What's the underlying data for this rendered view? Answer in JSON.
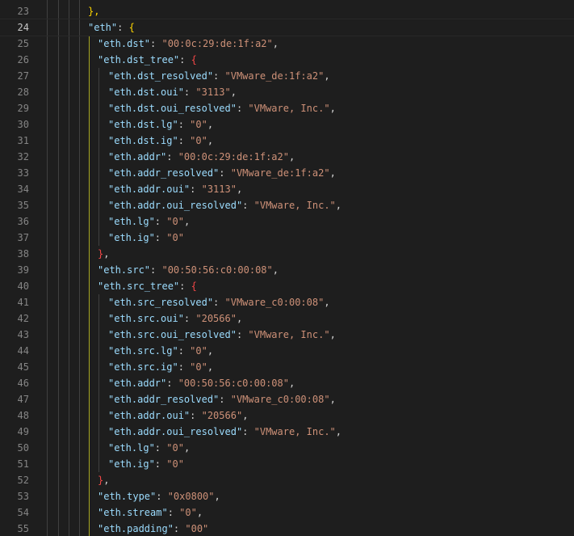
{
  "lines": [
    {
      "num": "23",
      "parts": [
        {
          "t": "},",
          "c": "b1"
        }
      ]
    },
    {
      "num": "24",
      "parts": [
        {
          "t": "\"eth\"",
          "c": "key"
        },
        {
          "t": ": ",
          "c": "punc"
        },
        {
          "t": "{",
          "c": "b1"
        }
      ]
    },
    {
      "num": "25",
      "parts": [
        {
          "t": "\"eth.dst\"",
          "c": "key"
        },
        {
          "t": ": ",
          "c": "punc"
        },
        {
          "t": "\"00:0c:29:de:1f:a2\"",
          "c": "str"
        },
        {
          "t": ",",
          "c": "punc"
        }
      ]
    },
    {
      "num": "26",
      "parts": [
        {
          "t": "\"eth.dst_tree\"",
          "c": "key"
        },
        {
          "t": ": ",
          "c": "punc"
        },
        {
          "t": "{",
          "c": "b3"
        }
      ]
    },
    {
      "num": "27",
      "parts": [
        {
          "t": "\"eth.dst_resolved\"",
          "c": "key"
        },
        {
          "t": ": ",
          "c": "punc"
        },
        {
          "t": "\"VMware_de:1f:a2\"",
          "c": "str"
        },
        {
          "t": ",",
          "c": "punc"
        }
      ]
    },
    {
      "num": "28",
      "parts": [
        {
          "t": "\"eth.dst.oui\"",
          "c": "key"
        },
        {
          "t": ": ",
          "c": "punc"
        },
        {
          "t": "\"3113\"",
          "c": "str"
        },
        {
          "t": ",",
          "c": "punc"
        }
      ]
    },
    {
      "num": "29",
      "parts": [
        {
          "t": "\"eth.dst.oui_resolved\"",
          "c": "key"
        },
        {
          "t": ": ",
          "c": "punc"
        },
        {
          "t": "\"VMware, Inc.\"",
          "c": "str"
        },
        {
          "t": ",",
          "c": "punc"
        }
      ]
    },
    {
      "num": "30",
      "parts": [
        {
          "t": "\"eth.dst.lg\"",
          "c": "key"
        },
        {
          "t": ": ",
          "c": "punc"
        },
        {
          "t": "\"0\"",
          "c": "str"
        },
        {
          "t": ",",
          "c": "punc"
        }
      ]
    },
    {
      "num": "31",
      "parts": [
        {
          "t": "\"eth.dst.ig\"",
          "c": "key"
        },
        {
          "t": ": ",
          "c": "punc"
        },
        {
          "t": "\"0\"",
          "c": "str"
        },
        {
          "t": ",",
          "c": "punc"
        }
      ]
    },
    {
      "num": "32",
      "parts": [
        {
          "t": "\"eth.addr\"",
          "c": "key"
        },
        {
          "t": ": ",
          "c": "punc"
        },
        {
          "t": "\"00:0c:29:de:1f:a2\"",
          "c": "str"
        },
        {
          "t": ",",
          "c": "punc"
        }
      ]
    },
    {
      "num": "33",
      "parts": [
        {
          "t": "\"eth.addr_resolved\"",
          "c": "key"
        },
        {
          "t": ": ",
          "c": "punc"
        },
        {
          "t": "\"VMware_de:1f:a2\"",
          "c": "str"
        },
        {
          "t": ",",
          "c": "punc"
        }
      ]
    },
    {
      "num": "34",
      "parts": [
        {
          "t": "\"eth.addr.oui\"",
          "c": "key"
        },
        {
          "t": ": ",
          "c": "punc"
        },
        {
          "t": "\"3113\"",
          "c": "str"
        },
        {
          "t": ",",
          "c": "punc"
        }
      ]
    },
    {
      "num": "35",
      "parts": [
        {
          "t": "\"eth.addr.oui_resolved\"",
          "c": "key"
        },
        {
          "t": ": ",
          "c": "punc"
        },
        {
          "t": "\"VMware, Inc.\"",
          "c": "str"
        },
        {
          "t": ",",
          "c": "punc"
        }
      ]
    },
    {
      "num": "36",
      "parts": [
        {
          "t": "\"eth.lg\"",
          "c": "key"
        },
        {
          "t": ": ",
          "c": "punc"
        },
        {
          "t": "\"0\"",
          "c": "str"
        },
        {
          "t": ",",
          "c": "punc"
        }
      ]
    },
    {
      "num": "37",
      "parts": [
        {
          "t": "\"eth.ig\"",
          "c": "key"
        },
        {
          "t": ": ",
          "c": "punc"
        },
        {
          "t": "\"0\"",
          "c": "str"
        }
      ]
    },
    {
      "num": "38",
      "parts": [
        {
          "t": "}",
          "c": "b3"
        },
        {
          "t": ",",
          "c": "punc"
        }
      ]
    },
    {
      "num": "39",
      "parts": [
        {
          "t": "\"eth.src\"",
          "c": "key"
        },
        {
          "t": ": ",
          "c": "punc"
        },
        {
          "t": "\"00:50:56:c0:00:08\"",
          "c": "str"
        },
        {
          "t": ",",
          "c": "punc"
        }
      ]
    },
    {
      "num": "40",
      "parts": [
        {
          "t": "\"eth.src_tree\"",
          "c": "key"
        },
        {
          "t": ": ",
          "c": "punc"
        },
        {
          "t": "{",
          "c": "b3"
        }
      ]
    },
    {
      "num": "41",
      "parts": [
        {
          "t": "\"eth.src_resolved\"",
          "c": "key"
        },
        {
          "t": ": ",
          "c": "punc"
        },
        {
          "t": "\"VMware_c0:00:08\"",
          "c": "str"
        },
        {
          "t": ",",
          "c": "punc"
        }
      ]
    },
    {
      "num": "42",
      "parts": [
        {
          "t": "\"eth.src.oui\"",
          "c": "key"
        },
        {
          "t": ": ",
          "c": "punc"
        },
        {
          "t": "\"20566\"",
          "c": "str"
        },
        {
          "t": ",",
          "c": "punc"
        }
      ]
    },
    {
      "num": "43",
      "parts": [
        {
          "t": "\"eth.src.oui_resolved\"",
          "c": "key"
        },
        {
          "t": ": ",
          "c": "punc"
        },
        {
          "t": "\"VMware, Inc.\"",
          "c": "str"
        },
        {
          "t": ",",
          "c": "punc"
        }
      ]
    },
    {
      "num": "44",
      "parts": [
        {
          "t": "\"eth.src.lg\"",
          "c": "key"
        },
        {
          "t": ": ",
          "c": "punc"
        },
        {
          "t": "\"0\"",
          "c": "str"
        },
        {
          "t": ",",
          "c": "punc"
        }
      ]
    },
    {
      "num": "45",
      "parts": [
        {
          "t": "\"eth.src.ig\"",
          "c": "key"
        },
        {
          "t": ": ",
          "c": "punc"
        },
        {
          "t": "\"0\"",
          "c": "str"
        },
        {
          "t": ",",
          "c": "punc"
        }
      ]
    },
    {
      "num": "46",
      "parts": [
        {
          "t": "\"eth.addr\"",
          "c": "key"
        },
        {
          "t": ": ",
          "c": "punc"
        },
        {
          "t": "\"00:50:56:c0:00:08\"",
          "c": "str"
        },
        {
          "t": ",",
          "c": "punc"
        }
      ]
    },
    {
      "num": "47",
      "parts": [
        {
          "t": "\"eth.addr_resolved\"",
          "c": "key"
        },
        {
          "t": ": ",
          "c": "punc"
        },
        {
          "t": "\"VMware_c0:00:08\"",
          "c": "str"
        },
        {
          "t": ",",
          "c": "punc"
        }
      ]
    },
    {
      "num": "48",
      "parts": [
        {
          "t": "\"eth.addr.oui\"",
          "c": "key"
        },
        {
          "t": ": ",
          "c": "punc"
        },
        {
          "t": "\"20566\"",
          "c": "str"
        },
        {
          "t": ",",
          "c": "punc"
        }
      ]
    },
    {
      "num": "49",
      "parts": [
        {
          "t": "\"eth.addr.oui_resolved\"",
          "c": "key"
        },
        {
          "t": ": ",
          "c": "punc"
        },
        {
          "t": "\"VMware, Inc.\"",
          "c": "str"
        },
        {
          "t": ",",
          "c": "punc"
        }
      ]
    },
    {
      "num": "50",
      "parts": [
        {
          "t": "\"eth.lg\"",
          "c": "key"
        },
        {
          "t": ": ",
          "c": "punc"
        },
        {
          "t": "\"0\"",
          "c": "str"
        },
        {
          "t": ",",
          "c": "punc"
        }
      ]
    },
    {
      "num": "51",
      "parts": [
        {
          "t": "\"eth.ig\"",
          "c": "key"
        },
        {
          "t": ": ",
          "c": "punc"
        },
        {
          "t": "\"0\"",
          "c": "str"
        }
      ]
    },
    {
      "num": "52",
      "parts": [
        {
          "t": "}",
          "c": "b3"
        },
        {
          "t": ",",
          "c": "punc"
        }
      ]
    },
    {
      "num": "53",
      "parts": [
        {
          "t": "\"eth.type\"",
          "c": "key"
        },
        {
          "t": ": ",
          "c": "punc"
        },
        {
          "t": "\"0x0800\"",
          "c": "str"
        },
        {
          "t": ",",
          "c": "punc"
        }
      ]
    },
    {
      "num": "54",
      "parts": [
        {
          "t": "\"eth.stream\"",
          "c": "key"
        },
        {
          "t": ": ",
          "c": "punc"
        },
        {
          "t": "\"0\"",
          "c": "str"
        },
        {
          "t": ",",
          "c": "punc"
        }
      ]
    },
    {
      "num": "55",
      "parts": [
        {
          "t": "\"eth.padding\"",
          "c": "key"
        },
        {
          "t": ": ",
          "c": "punc"
        },
        {
          "t": "\"00\"",
          "c": "str"
        }
      ]
    }
  ],
  "current_line": "24",
  "colors": {
    "background": "#1e1e1e",
    "key": "#9cdcfe",
    "string": "#ce9178",
    "bracket_level1": "#ffd700",
    "bracket_level3": "#f44747",
    "line_number": "#858585",
    "active_indent_guide": "#a8a823"
  }
}
